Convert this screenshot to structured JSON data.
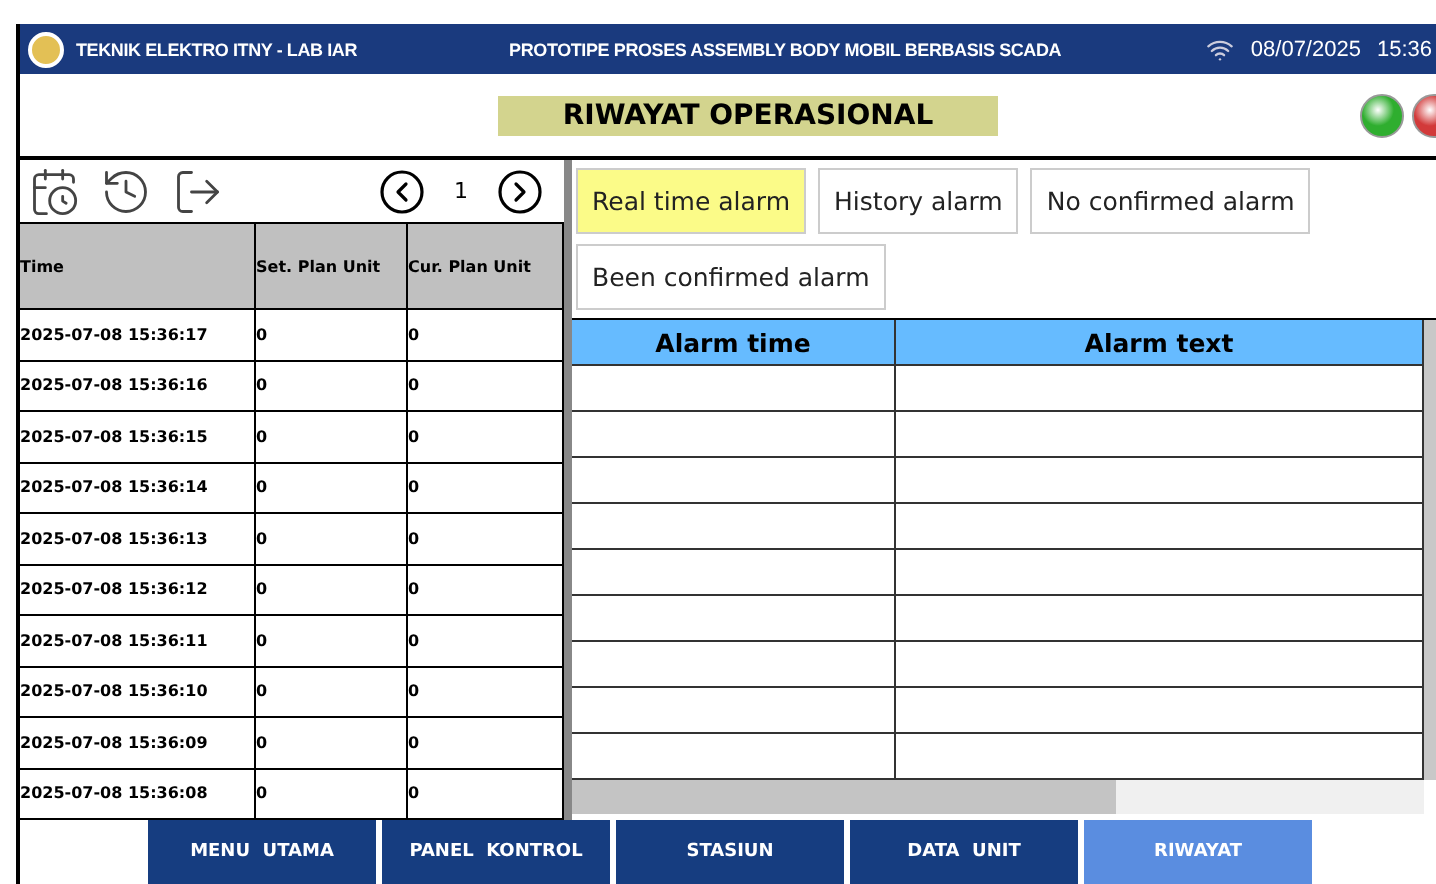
{
  "header": {
    "left_title": "TEKNIK ELEKTRO ITNY - LAB IAR",
    "center_title": "PROTOTIPE PROSES ASSEMBLY BODY MOBIL BERBASIS SCADA",
    "date": "08/07/2025",
    "time": "15:36"
  },
  "page_title": "RIWAYAT OPERASIONAL",
  "lamps": [
    {
      "color": "#2fae2f"
    },
    {
      "color": "#d23a3a"
    }
  ],
  "pager": {
    "page": "1"
  },
  "history_table": {
    "columns": [
      "Time",
      "Set. Plan Unit",
      "Cur. Plan Unit"
    ],
    "rows": [
      [
        "2025-07-08 15:36:17",
        "0",
        "0"
      ],
      [
        "2025-07-08 15:36:16",
        "0",
        "0"
      ],
      [
        "2025-07-08 15:36:15",
        "0",
        "0"
      ],
      [
        "2025-07-08 15:36:14",
        "0",
        "0"
      ],
      [
        "2025-07-08 15:36:13",
        "0",
        "0"
      ],
      [
        "2025-07-08 15:36:12",
        "0",
        "0"
      ],
      [
        "2025-07-08 15:36:11",
        "0",
        "0"
      ],
      [
        "2025-07-08 15:36:10",
        "0",
        "0"
      ],
      [
        "2025-07-08 15:36:09",
        "0",
        "0"
      ],
      [
        "2025-07-08 15:36:08",
        "0",
        "0"
      ]
    ]
  },
  "alarm_tabs": [
    {
      "label": "Real time alarm",
      "selected": true
    },
    {
      "label": "History alarm",
      "selected": false
    },
    {
      "label": "No confirmed alarm",
      "selected": false
    },
    {
      "label": "Been confirmed alarm",
      "selected": false
    }
  ],
  "alarm_table": {
    "columns": [
      "Alarm time",
      "Alarm text"
    ]
  },
  "nav": [
    {
      "label": "MENU  UTAMA",
      "selected": false
    },
    {
      "label": "PANEL  KONTROL",
      "selected": false
    },
    {
      "label": "STASIUN",
      "selected": false
    },
    {
      "label": "DATA  UNIT",
      "selected": false
    },
    {
      "label": "RIWAYAT",
      "selected": true
    }
  ]
}
